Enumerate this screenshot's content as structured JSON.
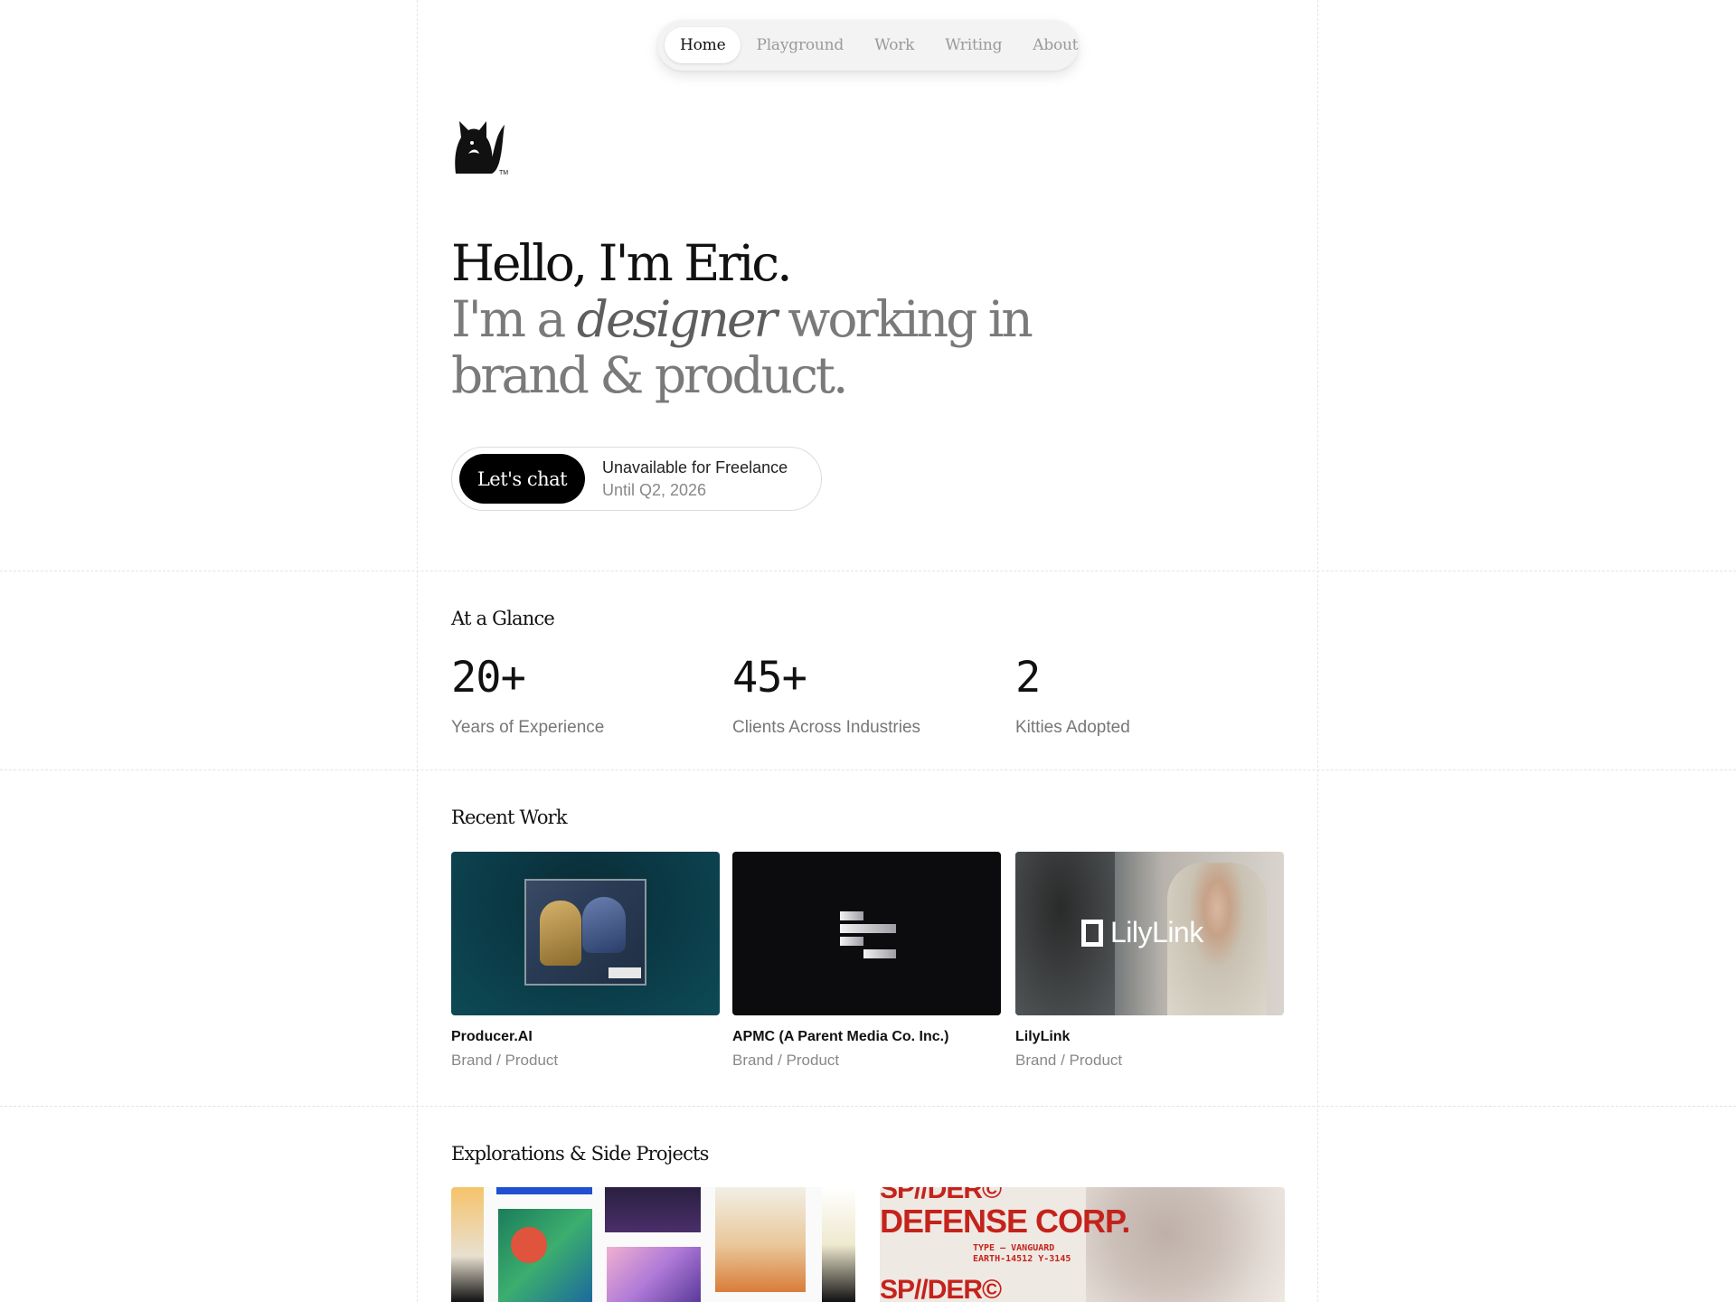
{
  "nav": {
    "items": [
      {
        "label": "Home",
        "active": true
      },
      {
        "label": "Playground",
        "active": false
      },
      {
        "label": "Work",
        "active": false
      },
      {
        "label": "Writing",
        "active": false
      },
      {
        "label": "About",
        "active": false
      }
    ]
  },
  "logo": {
    "icon": "cat-logo-icon",
    "mark": "TM"
  },
  "hero": {
    "greeting": "Hello, I'm Eric.",
    "line2_prefix": "I'm a ",
    "line2_em": "designer",
    "line2_suffix": " working in",
    "line3": "brand & product."
  },
  "cta": {
    "button_label": "Let's chat",
    "status": "Unavailable for Freelance",
    "until": "Until Q2, 2026"
  },
  "glance": {
    "title": "At a Glance",
    "stats": [
      {
        "value": "20+",
        "label": "Years of Experience"
      },
      {
        "value": "45+",
        "label": "Clients Across Industries"
      },
      {
        "value": "2",
        "label": "Kitties Adopted"
      }
    ]
  },
  "recent_work": {
    "title": "Recent Work",
    "items": [
      {
        "title": "Producer.AI",
        "subtitle": "Brand / Product"
      },
      {
        "title": "APMC (A Parent Media Co. Inc.)",
        "subtitle": "Brand / Product"
      },
      {
        "title": "LilyLink",
        "subtitle": "Brand / Product",
        "logo_text": "LilyLink"
      }
    ]
  },
  "explorations": {
    "title": "Explorations & Side Projects",
    "spider": {
      "line1": "SP//DER©",
      "line2": "DEFENSE CORP.",
      "type_label": "TYPE — VANGUARD",
      "coords": "EARTH-14512   Y-3145",
      "line3": "SP//DER©"
    }
  },
  "colors": {
    "accent": "#000000",
    "brand_red": "#c4231c",
    "muted": "#888888"
  }
}
